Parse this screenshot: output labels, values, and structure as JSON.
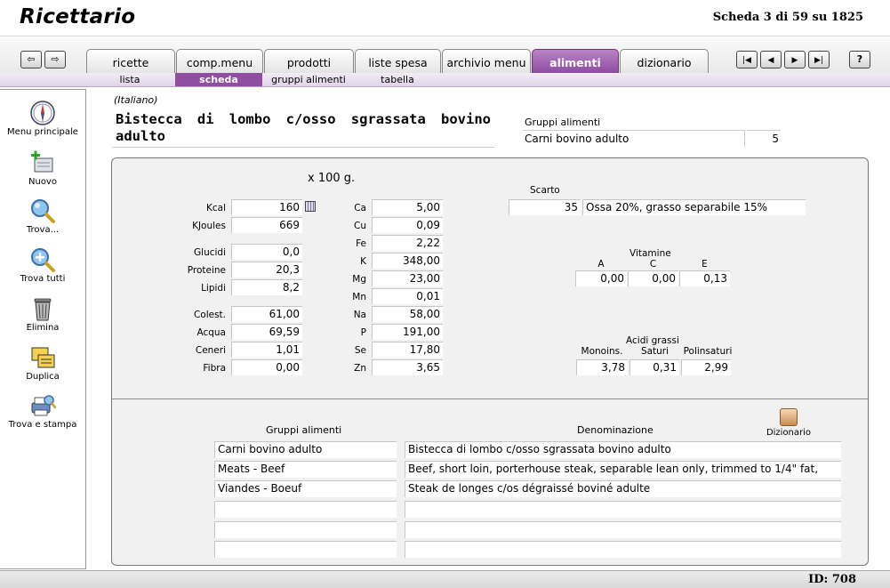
{
  "header": {
    "title": "Ricettario",
    "record_info": "Scheda 3 di 59 su 1825"
  },
  "toolbar": {
    "back_glyph": "⇦",
    "forward_glyph": "⇨",
    "tabs": [
      {
        "label": "ricette"
      },
      {
        "label": "comp.menu"
      },
      {
        "label": "prodotti"
      },
      {
        "label": "liste spesa"
      },
      {
        "label": "archivio menu"
      },
      {
        "label": "alimenti"
      },
      {
        "label": "dizionario"
      }
    ],
    "active_tab": "alimenti",
    "record_nav": {
      "first": "|◀",
      "prev": "◀",
      "next": "▶",
      "last": "▶|"
    },
    "help_label": "?"
  },
  "subtabs": {
    "items": [
      {
        "label": "lista"
      },
      {
        "label": "scheda"
      },
      {
        "label": "gruppi alimenti"
      },
      {
        "label": "tabella"
      }
    ],
    "active": "scheda"
  },
  "sidebar": {
    "items": [
      {
        "label": "Menu principale",
        "icon": "compass-icon"
      },
      {
        "label": "Nuovo",
        "icon": "new-record-icon"
      },
      {
        "label": "Trova...",
        "icon": "magnifier-icon"
      },
      {
        "label": "Trova tutti",
        "icon": "magnifier-plus-icon"
      },
      {
        "label": "Elimina",
        "icon": "trash-icon"
      },
      {
        "label": "Duplica",
        "icon": "duplicate-icon"
      },
      {
        "label": "Trova e stampa",
        "icon": "print-icon"
      }
    ]
  },
  "food": {
    "language": "(Italiano)",
    "name": "Bistecca di lombo c/osso sgrassata bovino adulto",
    "group_label": "Gruppi alimenti",
    "group": "Carni bovino adulto",
    "group_code": "5"
  },
  "nutrition": {
    "per_label": "x 100 g.",
    "energy": [
      {
        "label": "Kcal",
        "value": "160"
      },
      {
        "label": "KJoules",
        "value": "669"
      }
    ],
    "macros": [
      {
        "label": "Glucidi",
        "value": "0,0"
      },
      {
        "label": "Proteine",
        "value": "20,3"
      },
      {
        "label": "Lipidi",
        "value": "8,2"
      }
    ],
    "others": [
      {
        "label": "Colest.",
        "value": "61,00"
      },
      {
        "label": "Acqua",
        "value": "69,59"
      },
      {
        "label": "Ceneri",
        "value": "1,01"
      },
      {
        "label": "Fibra",
        "value": "0,00"
      }
    ],
    "minerals": [
      {
        "label": "Ca",
        "value": "5,00"
      },
      {
        "label": "Cu",
        "value": "0,09"
      },
      {
        "label": "Fe",
        "value": "2,22"
      },
      {
        "label": "K",
        "value": "348,00"
      },
      {
        "label": "Mg",
        "value": "23,00"
      },
      {
        "label": "Mn",
        "value": "0,01"
      },
      {
        "label": "Na",
        "value": "58,00"
      },
      {
        "label": "P",
        "value": "191,00"
      },
      {
        "label": "Se",
        "value": "17,80"
      },
      {
        "label": "Zn",
        "value": "3,65"
      }
    ],
    "waste": {
      "label": "Scarto",
      "value": "35",
      "note": "Ossa 20%, grasso separabile 15%"
    },
    "vitamins": {
      "label": "Vitamine",
      "items": [
        {
          "label": "A",
          "value": "0,00"
        },
        {
          "label": "C",
          "value": "0,00"
        },
        {
          "label": "E",
          "value": "0,13"
        }
      ]
    },
    "fatty_acids": {
      "label": "Acidi grassi",
      "items": [
        {
          "label": "Monoins.",
          "value": "3,78"
        },
        {
          "label": "Saturi",
          "value": "0,31"
        },
        {
          "label": "Polinsaturi",
          "value": "2,99"
        }
      ]
    }
  },
  "translations": {
    "group_header": "Gruppi alimenti",
    "name_header": "Denominazione",
    "dictionary_label": "Dizionario",
    "rows": [
      {
        "group": "Carni bovino adulto",
        "name": "Bistecca di lombo c/osso sgrassata bovino adulto"
      },
      {
        "group": "Meats - Beef",
        "name": "Beef, short loin, porterhouse steak, separable lean only, trimmed to 1/4\" fat,"
      },
      {
        "group": "Viandes - Boeuf",
        "name": "Steak de longes c/os dégraissé boviné adulte"
      },
      {
        "group": "",
        "name": ""
      },
      {
        "group": "",
        "name": ""
      },
      {
        "group": "",
        "name": ""
      }
    ]
  },
  "footer": {
    "id_label": "ID: 708"
  }
}
